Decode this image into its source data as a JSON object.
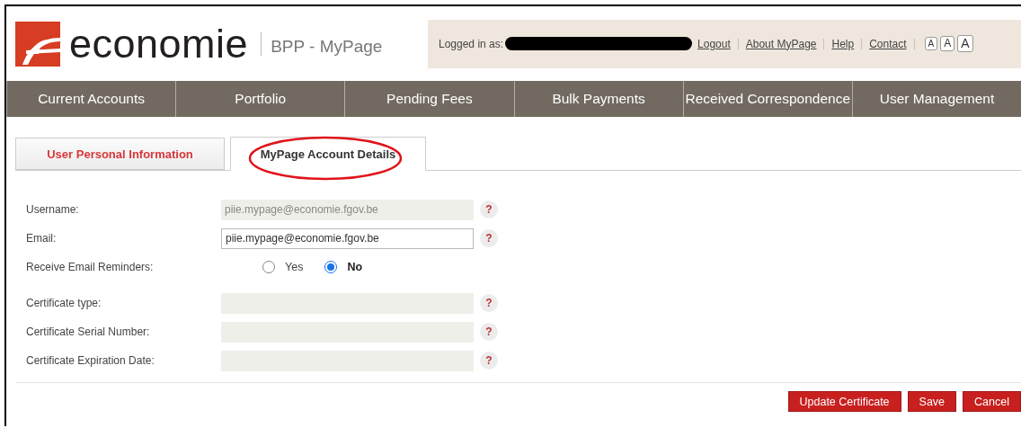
{
  "header": {
    "logo_text": "economie",
    "app_name": "BPP - MyPage",
    "logged_in_label": "Logged in as:",
    "links": [
      "Logout",
      "About MyPage",
      "Help",
      "Contact"
    ],
    "font_sizes": [
      "A",
      "A",
      "A"
    ]
  },
  "nav": [
    "Current Accounts",
    "Portfolio",
    "Pending Fees",
    "Bulk Payments",
    "Received Correspondence",
    "User Management"
  ],
  "tabs": [
    {
      "label": "User Personal Information",
      "selected": false,
      "circled": false
    },
    {
      "label": "MyPage Account Details",
      "selected": true,
      "circled": true
    }
  ],
  "fields": [
    {
      "kind": "readonly",
      "label": "Username:",
      "value": "piie.mypage@economie.fgov.be",
      "help": "?"
    },
    {
      "kind": "text",
      "label": "Email:",
      "value": "piie.mypage@economie.fgov.be",
      "help": "?"
    },
    {
      "kind": "radio",
      "label": "Receive Email Reminders:",
      "options": [
        {
          "label": "Yes",
          "selected": false
        },
        {
          "label": "No",
          "selected": true
        }
      ]
    },
    {
      "kind": "readonly",
      "label": "Certificate type:",
      "help": "?"
    },
    {
      "kind": "readonly",
      "label": "Certificate Serial Number:",
      "help": "?"
    },
    {
      "kind": "readonly",
      "label": "Certificate Expiration Date:",
      "help": "?"
    }
  ],
  "buttons": [
    "Update Certificate",
    "Save",
    "Cancel"
  ]
}
